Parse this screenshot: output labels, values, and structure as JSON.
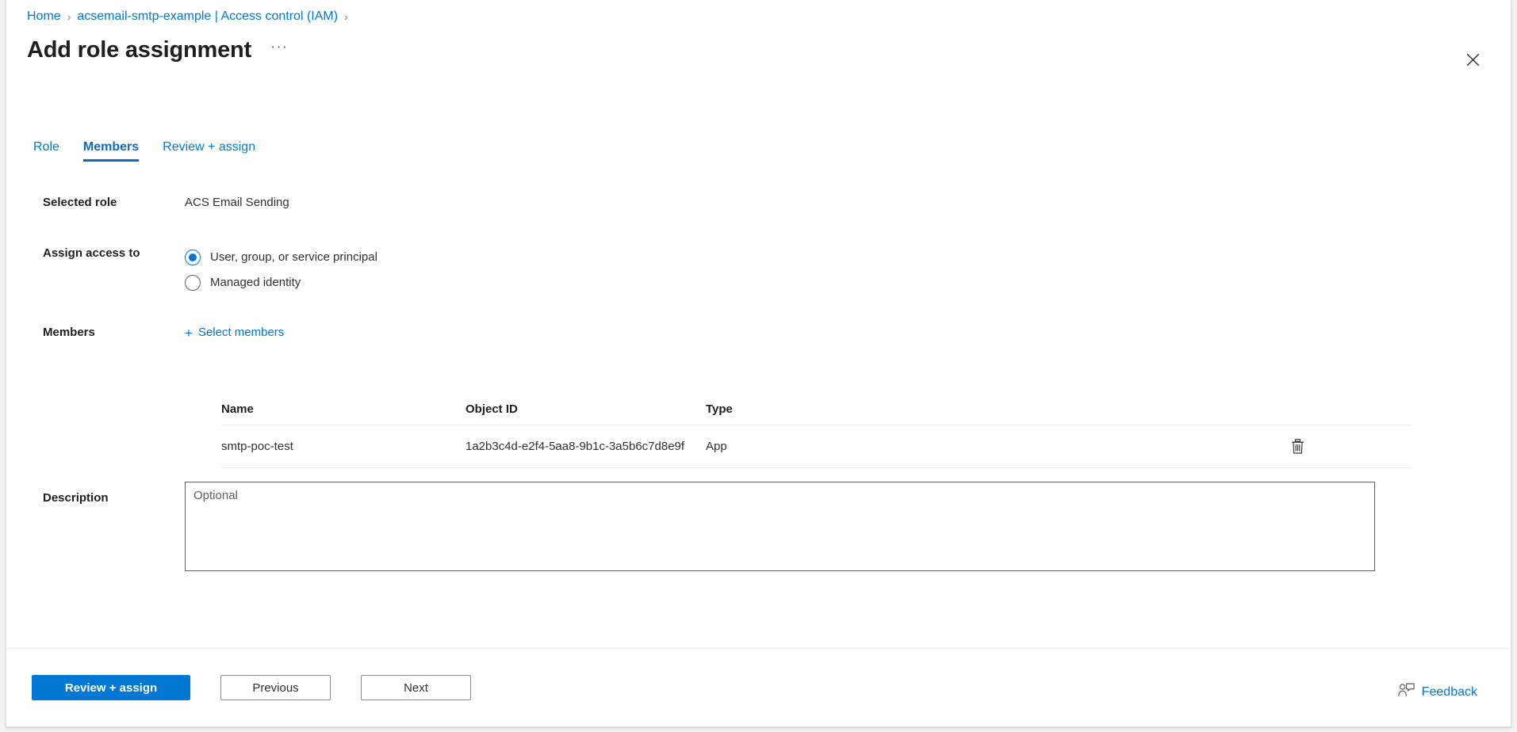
{
  "breadcrumb": {
    "items": [
      {
        "label": "Home"
      },
      {
        "label": "acsemail-smtp-example | Access control (IAM)"
      }
    ],
    "separator": "›"
  },
  "header": {
    "title": "Add role assignment",
    "more_label": "···",
    "more_icon": "ellipsis-icon",
    "close_icon": "close-icon"
  },
  "tabs": [
    {
      "label": "Role",
      "active": false
    },
    {
      "label": "Members",
      "active": true
    },
    {
      "label": "Review + assign",
      "active": false
    }
  ],
  "form": {
    "selected_role": {
      "label": "Selected role",
      "value": "ACS Email Sending"
    },
    "assign_access_to": {
      "label": "Assign access to",
      "options": [
        {
          "label": "User, group, or service principal",
          "checked": true
        },
        {
          "label": "Managed identity",
          "checked": false
        }
      ]
    },
    "members": {
      "label": "Members",
      "select_members_label": "Select members",
      "plus_glyph": "+"
    },
    "description": {
      "label": "Description",
      "placeholder": "Optional",
      "value": ""
    }
  },
  "members_table": {
    "columns": [
      "Name",
      "Object ID",
      "Type"
    ],
    "rows": [
      {
        "name": "smtp-poc-test",
        "object_id": "1a2b3c4d-e2f4-5aa8-9b1c-3a5b6c7d8e9f",
        "type": "App",
        "delete_icon": "trash-icon"
      }
    ]
  },
  "footer": {
    "primary_label": "Review + assign",
    "previous_label": "Previous",
    "next_label": "Next",
    "feedback_label": "Feedback",
    "feedback_icon": "feedback-person-icon"
  },
  "colors": {
    "accent": "#0078d4",
    "tab_active": "#0f6cbd",
    "text": "#323130",
    "heading": "#201f1e",
    "border": "#edebe9",
    "control_border": "#605e5c"
  }
}
